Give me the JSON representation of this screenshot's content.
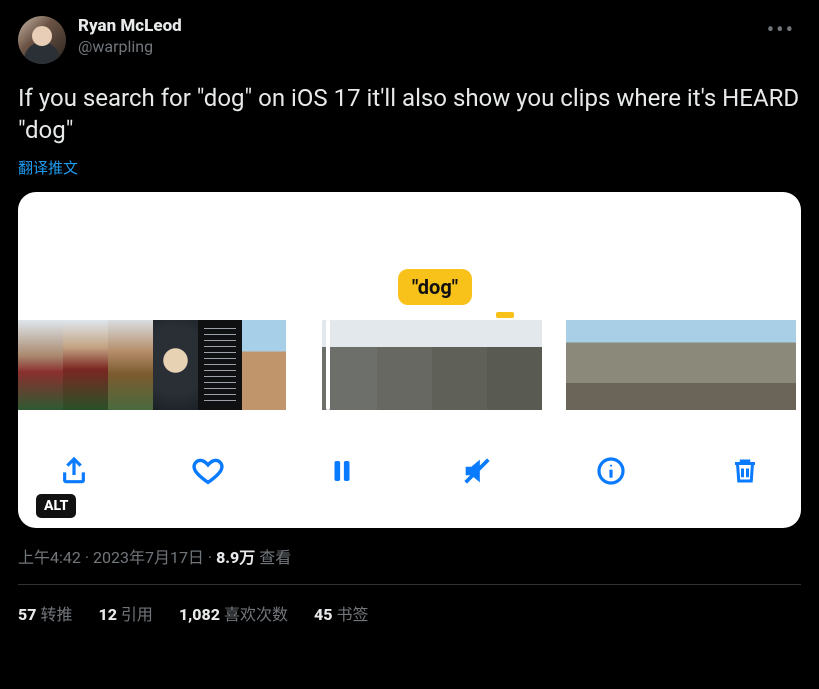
{
  "author": {
    "display_name": "Ryan McLeod",
    "handle": "@warpling"
  },
  "tweet_text": "If you search for \"dog\" on iOS 17 it'll also show you clips where it's HEARD \"dog\"",
  "translate_label": "翻译推文",
  "media": {
    "badge_text": "\"dog\"",
    "alt_label": "ALT",
    "toolbar": {
      "share": "share-icon",
      "like": "heart-icon",
      "pause": "pause-icon",
      "mute": "mute-icon",
      "info": "info-icon",
      "trash": "trash-icon"
    }
  },
  "meta": {
    "time": "上午4:42",
    "sep1": " · ",
    "date": "2023年7月17日",
    "sep2": " · ",
    "views_num": "8.9万",
    "views_label": " 查看"
  },
  "stats": {
    "retweets_num": "57",
    "retweets_label": "转推",
    "quotes_num": "12",
    "quotes_label": "引用",
    "likes_num": "1,082",
    "likes_label": "喜欢次数",
    "bookmarks_num": "45",
    "bookmarks_label": "书签"
  }
}
